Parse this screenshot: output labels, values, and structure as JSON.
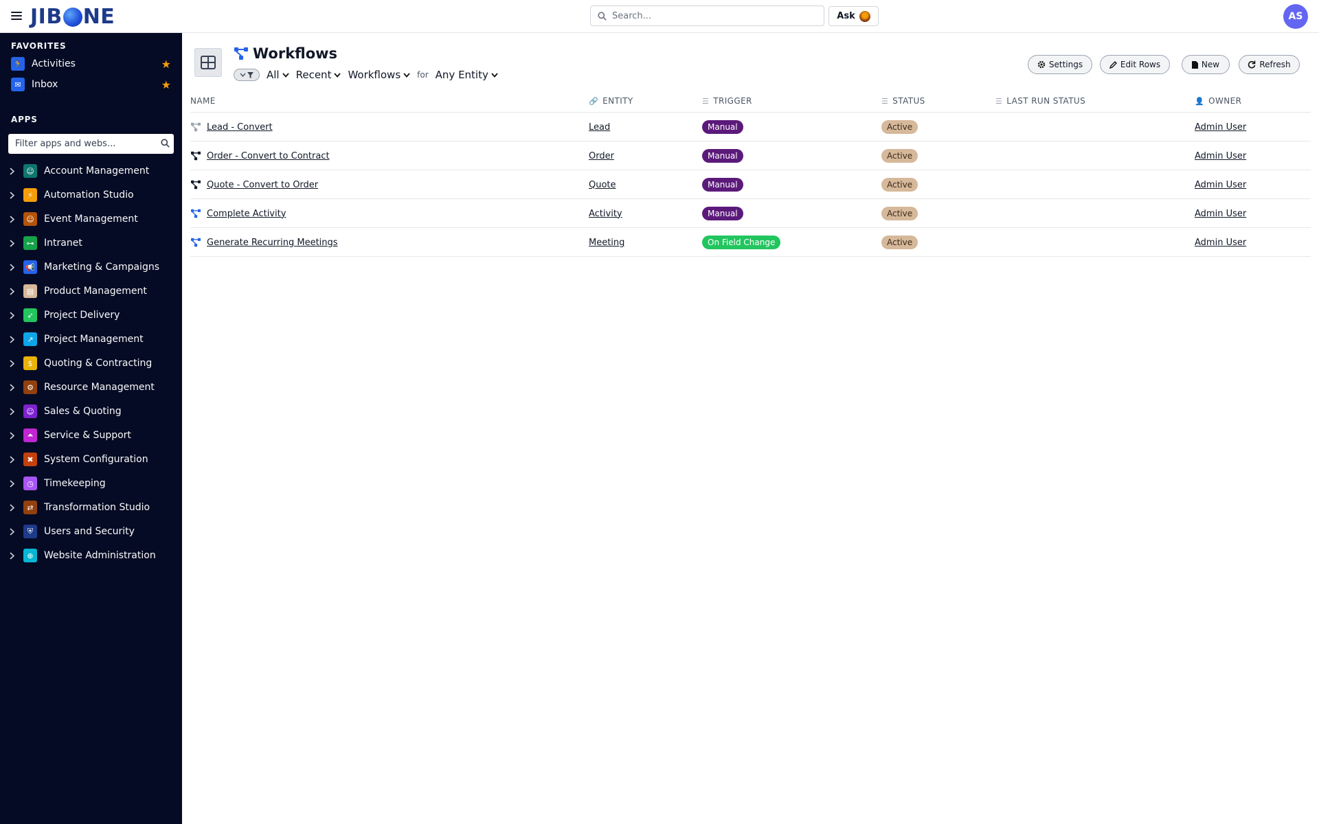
{
  "header": {
    "logo_text_a": "JIB",
    "logo_text_b": "NE",
    "search_placeholder": "Search...",
    "ask_label": "Ask",
    "user_initials": "AS"
  },
  "sidebar": {
    "favorites_heading": "FAVORITES",
    "favorites": [
      {
        "label": "Activities",
        "icon": "running-person-icon",
        "color": "#2563eb"
      },
      {
        "label": "Inbox",
        "icon": "envelope-icon",
        "color": "#2563eb"
      }
    ],
    "apps_heading": "APPS",
    "filter_placeholder": "Filter apps and webs...",
    "apps": [
      {
        "label": "Account Management",
        "icon": "person-hand-icon",
        "color": "#0f766e"
      },
      {
        "label": "Automation Studio",
        "icon": "bolt-icon",
        "color": "#f59e0b"
      },
      {
        "label": "Event Management",
        "icon": "person-hand-icon",
        "color": "#b45309"
      },
      {
        "label": "Intranet",
        "icon": "sitemap-icon",
        "color": "#16a34a"
      },
      {
        "label": "Marketing & Campaigns",
        "icon": "megaphone-icon",
        "color": "#2563eb"
      },
      {
        "label": "Product Management",
        "icon": "box-icon",
        "color": "#d6b89a"
      },
      {
        "label": "Project Delivery",
        "icon": "rocket-icon",
        "color": "#22c55e"
      },
      {
        "label": "Project Management",
        "icon": "chart-line-icon",
        "color": "#0ea5e9"
      },
      {
        "label": "Quoting & Contracting",
        "icon": "hand-coins-icon",
        "color": "#eab308"
      },
      {
        "label": "Resource Management",
        "icon": "user-gear-icon",
        "color": "#92400e"
      },
      {
        "label": "Sales & Quoting",
        "icon": "person-hand-icon",
        "color": "#7e22ce"
      },
      {
        "label": "Service & Support",
        "icon": "bell-icon",
        "color": "#c026d3"
      },
      {
        "label": "System Configuration",
        "icon": "tools-icon",
        "color": "#c2410c"
      },
      {
        "label": "Timekeeping",
        "icon": "clock-icon",
        "color": "#a855f7"
      },
      {
        "label": "Transformation Studio",
        "icon": "arrows-swap-icon",
        "color": "#92400e"
      },
      {
        "label": "Users and Security",
        "icon": "shield-icon",
        "color": "#1e3a8a"
      },
      {
        "label": "Website Administration",
        "icon": "globe-icon",
        "color": "#06b6d4"
      }
    ]
  },
  "main": {
    "title": "Workflows",
    "filters": {
      "scope": "All",
      "recent": "Recent",
      "type": "Workflows",
      "for_label": "for",
      "entity": "Any Entity"
    },
    "actions": {
      "settings": "Settings",
      "edit_rows": "Edit Rows",
      "new": "New",
      "refresh": "Refresh"
    },
    "columns": {
      "name": "NAME",
      "entity": "ENTITY",
      "trigger": "TRIGGER",
      "status": "STATUS",
      "last_run_status": "LAST RUN STATUS",
      "owner": "OWNER"
    },
    "rows": [
      {
        "name": "Lead - Convert",
        "entity": "Lead",
        "trigger": "Manual",
        "trigger_kind": "manual",
        "status": "Active",
        "last_run_status": "",
        "owner": "Admin User",
        "icon_color": "#9ca3af"
      },
      {
        "name": "Order - Convert to Contract",
        "entity": "Order",
        "trigger": "Manual",
        "trigger_kind": "manual",
        "status": "Active",
        "last_run_status": "",
        "owner": "Admin User",
        "icon_color": "#111827"
      },
      {
        "name": "Quote - Convert to Order",
        "entity": "Quote",
        "trigger": "Manual",
        "trigger_kind": "manual",
        "status": "Active",
        "last_run_status": "",
        "owner": "Admin User",
        "icon_color": "#111827"
      },
      {
        "name": "Complete Activity",
        "entity": "Activity",
        "trigger": "Manual",
        "trigger_kind": "manual",
        "status": "Active",
        "last_run_status": "",
        "owner": "Admin User",
        "icon_color": "#2563eb"
      },
      {
        "name": "Generate Recurring Meetings",
        "entity": "Meeting",
        "trigger": "On Field Change",
        "trigger_kind": "field",
        "status": "Active",
        "last_run_status": "",
        "owner": "Admin User",
        "icon_color": "#2563eb"
      }
    ]
  }
}
